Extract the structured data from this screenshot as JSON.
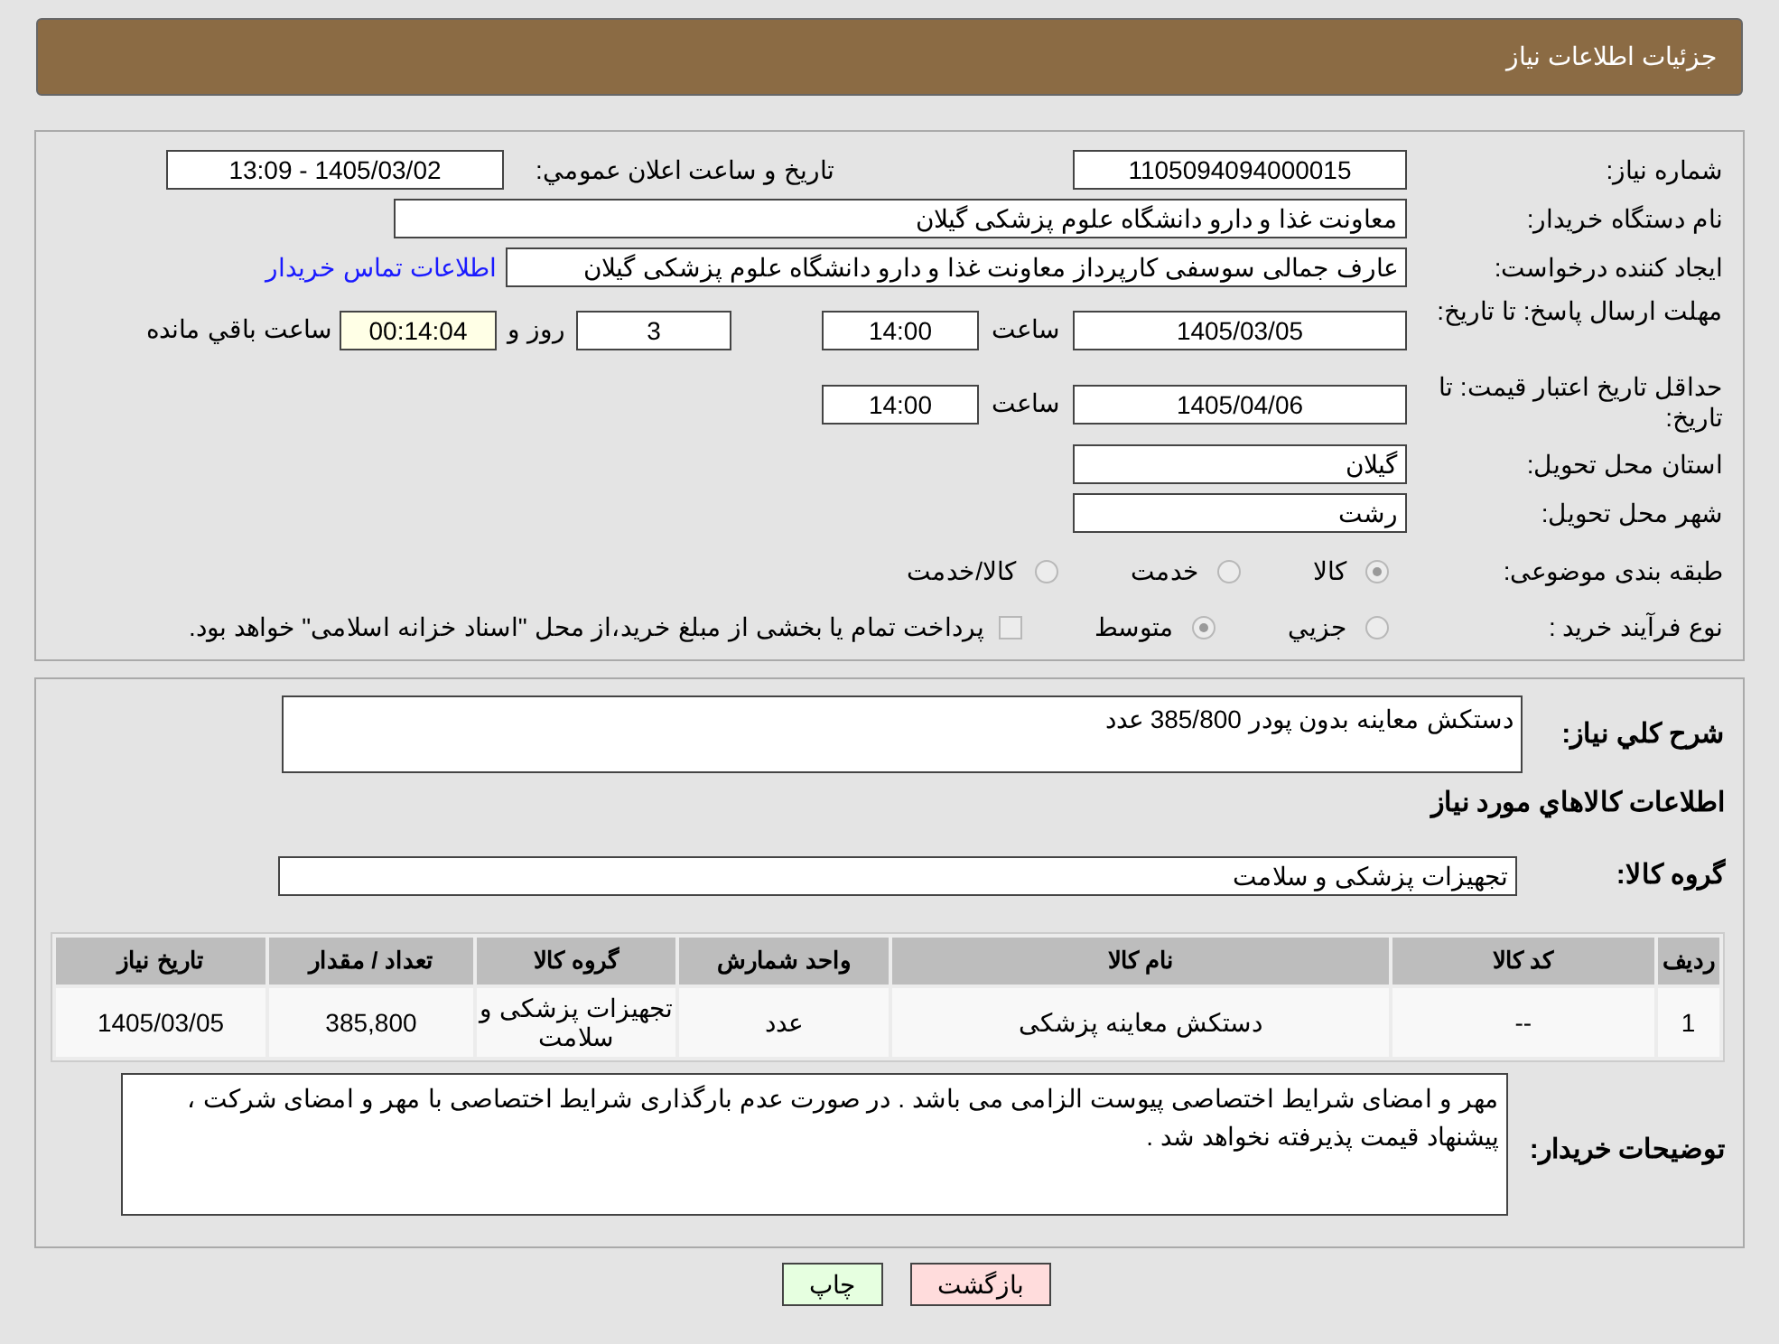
{
  "header": {
    "title": "جزئیات اطلاعات نیاز"
  },
  "need_number": {
    "label": "شماره نیاز:",
    "value": "1105094094000015"
  },
  "announce": {
    "label": "تاریخ و ساعت اعلان عمومي:",
    "value": "1405/03/02 - 13:09"
  },
  "buyer": {
    "label": "نام دستگاه خریدار:",
    "value": "معاونت غذا و دارو دانشگاه علوم پزشکی گیلان"
  },
  "creator": {
    "label": "ایجاد کننده درخواست:",
    "value": "عارف جمالی سوسفی کارپرداز معاونت غذا و دارو دانشگاه علوم پزشکی گیلان",
    "link": "اطلاعات تماس خریدار"
  },
  "reply_deadline": {
    "label": "مهلت ارسال پاسخ: تا تاریخ:",
    "date": "1405/03/05",
    "time_label": "ساعت",
    "time": "14:00",
    "days": "3",
    "days_label": "روز و",
    "remaining": "00:14:04",
    "remaining_label": "ساعت باقي مانده"
  },
  "price_validity": {
    "label": "حداقل تاریخ اعتبار قیمت: تا تاریخ:",
    "date": "1405/04/06",
    "time_label": "ساعت",
    "time": "14:00"
  },
  "province": {
    "label": "استان محل تحویل:",
    "value": "گیلان"
  },
  "city": {
    "label": "شهر محل تحویل:",
    "value": "رشت"
  },
  "category": {
    "label": "طبقه بندی موضوعی:",
    "options": [
      {
        "label": "کالا",
        "selected": true
      },
      {
        "label": "خدمت",
        "selected": false
      },
      {
        "label": "کالا/خدمت",
        "selected": false
      }
    ]
  },
  "purchase_type": {
    "label": "نوع فرآیند خرید :",
    "options": [
      {
        "label": "جزيي",
        "selected": false
      },
      {
        "label": "متوسط",
        "selected": true
      }
    ],
    "note": {
      "checked": false,
      "text": "پرداخت تمام یا بخشی از مبلغ خرید،از محل \"اسناد خزانه اسلامی\" خواهد بود."
    }
  },
  "description": {
    "label": "شرح کلي نیاز:",
    "value": "دستکش معاینه بدون پودر 385/800 عدد"
  },
  "goods_heading": "اطلاعات کالاهاي مورد نیاز",
  "goods_group": {
    "label": "گروه کالا:",
    "value": "تجهیزات پزشکی و سلامت"
  },
  "table": {
    "columns": [
      "ردیف",
      "کد کالا",
      "نام کالا",
      "واحد شمارش",
      "گروه کالا",
      "تعداد / مقدار",
      "تاریخ نیاز"
    ],
    "rows": [
      [
        "1",
        "--",
        "دستکش معاینه پزشکی",
        "عدد",
        "تجهیزات پزشکی و سلامت",
        "385,800",
        "1405/03/05"
      ]
    ]
  },
  "buyer_notes": {
    "label": "توضیحات خریدار:",
    "value": "مهر و امضای شرایط اختصاصی پیوست الزامی می باشد . در صورت عدم بارگذاری شرایط اختصاصی با مهر و امضای شرکت ، پیشنهاد قیمت پذیرفته نخواهد شد ."
  },
  "buttons": [
    {
      "label": "بازگشت",
      "kind": "back"
    },
    {
      "label": "چاپ",
      "kind": "print"
    }
  ]
}
